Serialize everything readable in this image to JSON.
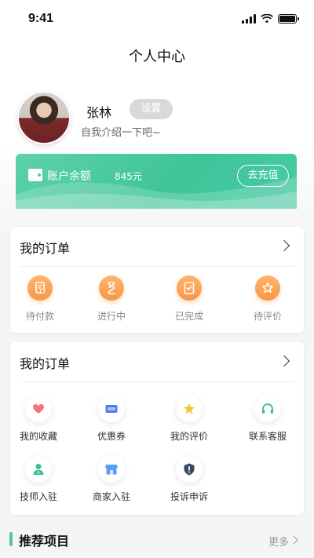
{
  "status_bar": {
    "time": "9:41"
  },
  "header": {
    "title": "个人中心"
  },
  "profile": {
    "name": "张林",
    "settings_label": "设置",
    "intro": "自我介绍一下吧~"
  },
  "balance": {
    "label": "账户余额",
    "amount": "845元",
    "recharge_label": "去充值",
    "icon": "wallet-icon"
  },
  "orders": {
    "title": "我的订单",
    "items": [
      {
        "label": "待付款",
        "icon": "payment-icon"
      },
      {
        "label": "进行中",
        "icon": "hourglass-icon"
      },
      {
        "label": "已完成",
        "icon": "completed-doc-icon"
      },
      {
        "label": "待评价",
        "icon": "star-icon"
      }
    ]
  },
  "services": {
    "title": "我的订单",
    "items": [
      {
        "label": "我的收藏",
        "icon": "heart-icon"
      },
      {
        "label": "优惠券",
        "icon": "coupon-icon"
      },
      {
        "label": "我的评价",
        "icon": "star-icon"
      },
      {
        "label": "联系客服",
        "icon": "headset-icon"
      },
      {
        "label": "技师入驻",
        "icon": "technician-icon"
      },
      {
        "label": "商家入驻",
        "icon": "store-icon"
      },
      {
        "label": "投诉申诉",
        "icon": "complaint-shield-icon"
      }
    ]
  },
  "recommend": {
    "title": "推荐项目",
    "more_label": "更多"
  },
  "colors": {
    "accent_green": "#4cc9a0",
    "order_orange": "#f79746"
  }
}
